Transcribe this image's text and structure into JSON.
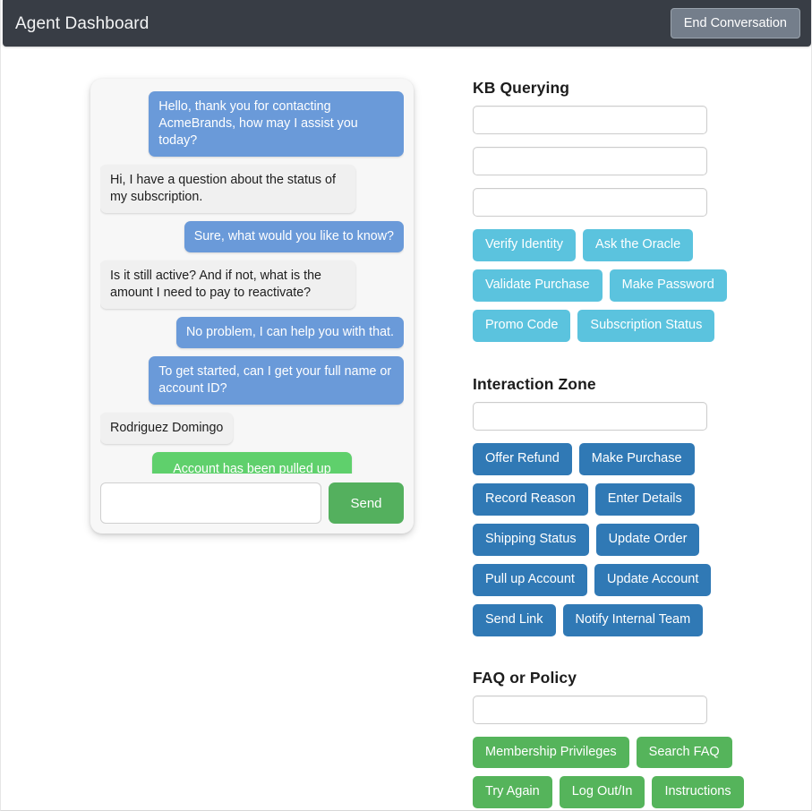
{
  "header": {
    "title": "Agent Dashboard",
    "end_conversation_label": "End Conversation"
  },
  "chat": {
    "messages": [
      {
        "role": "agent",
        "text": "Hello, thank you for contacting AcmeBrands, how may I assist you today?"
      },
      {
        "role": "user",
        "text": "Hi, I have a question about the status of my subscription."
      },
      {
        "role": "agent",
        "text": "Sure, what would you like to know?"
      },
      {
        "role": "user",
        "text": "Is it still active? And if not, what is the amount I need to pay to reactivate?"
      },
      {
        "role": "agent",
        "text": "No problem, I can help you with that."
      },
      {
        "role": "agent",
        "text": "To get started, can I get your full name or account ID?"
      },
      {
        "role": "user",
        "text": "Rodriguez Domingo"
      },
      {
        "role": "system",
        "text": "Account has been pulled up for Rodriguez Domingo."
      }
    ],
    "input_value": "",
    "input_placeholder": "",
    "send_label": "Send"
  },
  "kb_querying": {
    "title": "KB Querying",
    "fields": [
      {
        "value": "",
        "placeholder": ""
      },
      {
        "value": "",
        "placeholder": ""
      },
      {
        "value": "",
        "placeholder": ""
      }
    ],
    "buttons": [
      "Verify Identity",
      "Ask the Oracle",
      "Validate Purchase",
      "Make Password",
      "Promo Code",
      "Subscription Status"
    ]
  },
  "interaction_zone": {
    "title": "Interaction Zone",
    "fields": [
      {
        "value": "",
        "placeholder": ""
      }
    ],
    "buttons": [
      "Offer Refund",
      "Make Purchase",
      "Record Reason",
      "Enter Details",
      "Shipping Status",
      "Update Order",
      "Pull up Account",
      "Update Account",
      "Send Link",
      "Notify Internal Team"
    ]
  },
  "faq_or_policy": {
    "title": "FAQ or Policy",
    "fields": [
      {
        "value": "",
        "placeholder": ""
      }
    ],
    "buttons": [
      "Membership Privileges",
      "Search FAQ",
      "Try Again",
      "Log Out/In",
      "Instructions"
    ]
  },
  "colors": {
    "header_bg": "#383d45",
    "end_conversation_bg": "#747e8b",
    "agent_bubble": "#6a9ad9",
    "user_bubble": "#f0f0f0",
    "system_bubble": "#5fd06c",
    "send_button": "#54b05e",
    "kb_button": "#5bc3de",
    "interaction_button": "#3079b5",
    "faq_button": "#55b45b",
    "chat_panel_bg": "#f7f7f7"
  }
}
